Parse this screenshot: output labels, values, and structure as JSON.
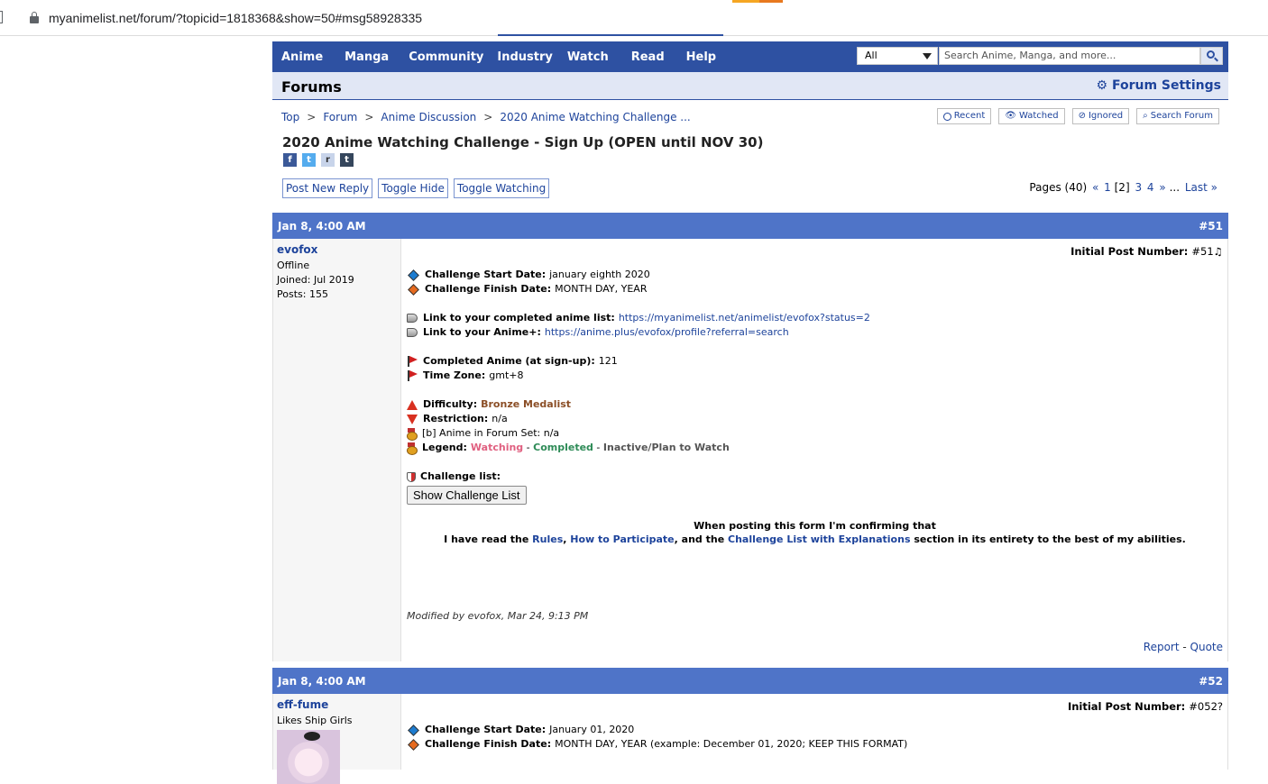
{
  "browser": {
    "url": "myanimelist.net/forum/?topicid=1818368&show=50#msg58928335"
  },
  "nav": {
    "items": [
      "Anime",
      "Manga",
      "Community",
      "Industry",
      "Watch",
      "Read",
      "Help"
    ],
    "search_category": "All",
    "search_placeholder": "Search Anime, Manga, and more..."
  },
  "header": {
    "title": "Forums",
    "settings": "Forum Settings"
  },
  "breadcrumb": [
    "Top",
    "Forum",
    "Anime Discussion",
    "2020 Anime Watching Challenge ..."
  ],
  "tools": [
    "Recent",
    "Watched",
    "Ignored",
    "Search Forum"
  ],
  "topic_title": "2020 Anime Watching Challenge - Sign Up (OPEN until NOV 30)",
  "share": [
    "f",
    "t",
    "r",
    "t"
  ],
  "actions": [
    "Post New Reply",
    "Toggle Hide",
    "Toggle Watching"
  ],
  "pages": {
    "label": "Pages (40)",
    "prev": "«",
    "p1": "1",
    "current": "[2]",
    "p3": "3",
    "p4": "4",
    "next": "»",
    "ellipsis": "...",
    "last": "Last »"
  },
  "post1": {
    "date": "Jan 8, 4:00 AM",
    "number": "#51",
    "user": "evofox",
    "status": "Offline",
    "joined": "Joined: Jul 2019",
    "posts": "Posts: 155",
    "ipn_label": "Initial Post Number:",
    "ipn_value": "#51♫",
    "start_label": "Challenge Start Date:",
    "start_value": "january eighth 2020",
    "finish_label": "Challenge Finish Date:",
    "finish_value": "MONTH DAY, YEAR",
    "list_label": "Link to your completed anime list:",
    "list_value": "https://myanimelist.net/animelist/evofox?status=2",
    "animeplus_label": "Link to your Anime+:",
    "animeplus_value": "https://anime.plus/evofox/profile?referral=search",
    "completed_label": "Completed Anime (at sign-up):",
    "completed_value": "121",
    "tz_label": "Time Zone:",
    "tz_value": "gmt+8",
    "difficulty_label": "Difficulty:",
    "difficulty_value": "Bronze Medalist",
    "restriction_label": "Restriction:",
    "restriction_value": "n/a",
    "forumset": "[b] Anime in Forum Set: n/a",
    "legend_label": "Legend:",
    "legend_watching": "Watching",
    "legend_dash1": " - ",
    "legend_completed": "Completed",
    "legend_dash2": " - ",
    "legend_inactive": "Inactive/Plan to Watch",
    "challenge_label": "Challenge list:",
    "show_button": "Show Challenge List",
    "confirm1": "When posting this form I'm confirming that",
    "confirm2a": "I have read the ",
    "confirm2_rules": "Rules",
    "confirm2b": ", ",
    "confirm2_how": "How to Participate",
    "confirm2c": ", and the ",
    "confirm2_list": "Challenge List with Explanations",
    "confirm2d": " section in its entirety to the best of my abilities.",
    "modified": "Modified by evofox, Mar 24, 9:13 PM",
    "report": "Report",
    "dash": " - ",
    "quote": "Quote"
  },
  "post2": {
    "date": "Jan 8, 4:00 AM",
    "number": "#52",
    "user": "eff-fume",
    "tagline": "Likes Ship Girls",
    "ipn_label": "Initial Post Number:",
    "ipn_value": "#052?",
    "start_label": "Challenge Start Date:",
    "start_value": "January 01, 2020",
    "finish_label": "Challenge Finish Date:",
    "finish_value": "MONTH DAY, YEAR (example: December 01, 2020; KEEP THIS FORMAT)"
  },
  "colors": {
    "nav": "#2e51a2",
    "post_bar": "#4f74c8",
    "link": "#1d439b",
    "header_bg": "#e1e7f5"
  }
}
